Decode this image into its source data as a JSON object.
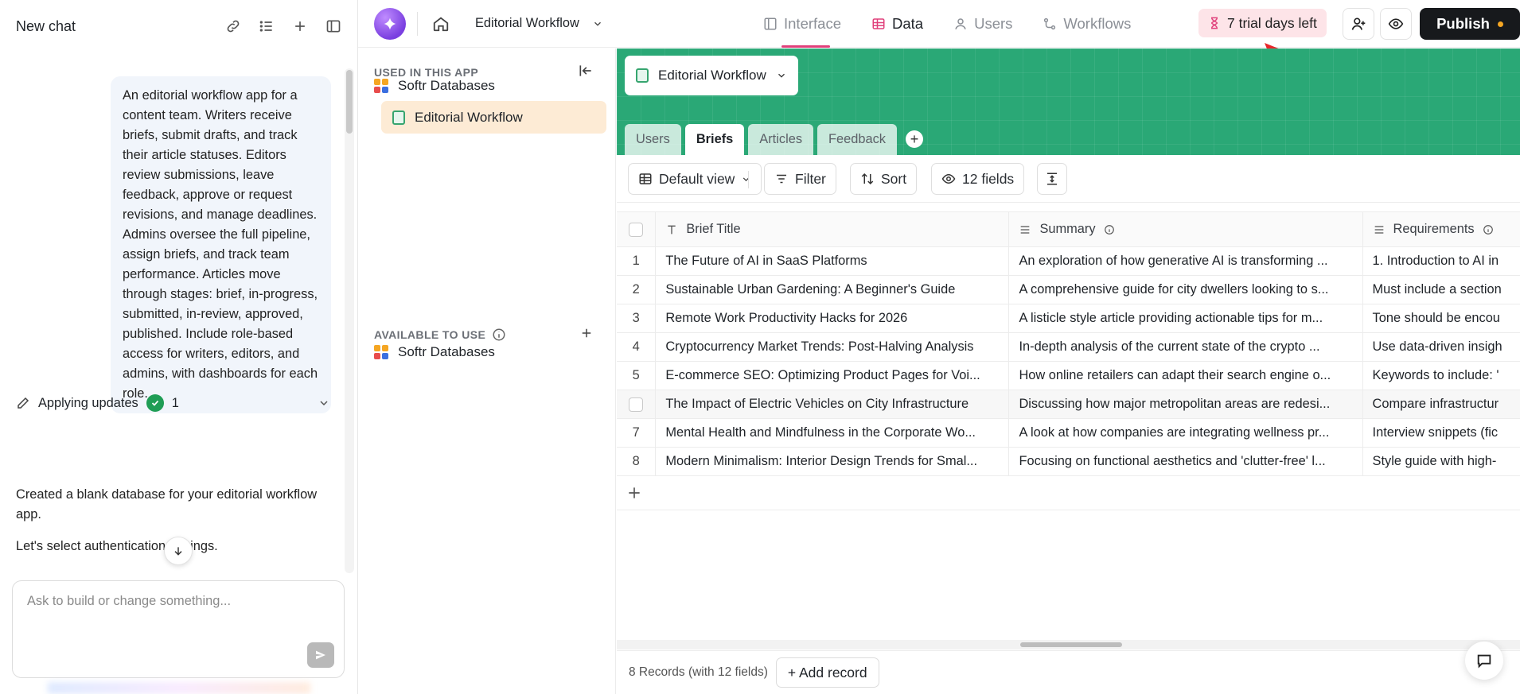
{
  "chat": {
    "title": "New chat",
    "prompt": "An editorial workflow app for a content team. Writers receive briefs, submit drafts, and track their article statuses. Editors review submissions, leave feedback, approve or request revisions, and manage deadlines. Admins oversee the full pipeline, assign briefs, and track team performance. Articles move through stages: brief, in-progress, submitted, in-review, approved, published. Include role-based access for writers, editors, and admins, with dashboards for each role.",
    "status_label": "Applying updates",
    "status_count": "1",
    "message1": "Created a blank database for your editorial workflow app.",
    "message2": "Let's select authentication settings.",
    "input_placeholder": "Ask to build or change something..."
  },
  "topbar": {
    "app_name": "Editorial Workflow",
    "nav": [
      {
        "label": "Interface"
      },
      {
        "label": "Data"
      },
      {
        "label": "Users"
      },
      {
        "label": "Workflows"
      }
    ],
    "active_nav": "Data",
    "trial_text": "7 trial days left",
    "publish_label": "Publish",
    "accent_color": "#e0407b"
  },
  "sidebar": {
    "used_label": "USED IN THIS APP",
    "used_items": [
      {
        "label": "Softr Databases"
      },
      {
        "label": "Editorial Workflow"
      }
    ],
    "available_label": "AVAILABLE TO USE",
    "available_items": [
      {
        "label": "Softr Databases"
      }
    ]
  },
  "database": {
    "name": "Editorial Workflow",
    "banner_color": "#2aa876",
    "tabs": [
      {
        "label": "Users"
      },
      {
        "label": "Briefs"
      },
      {
        "label": "Articles"
      },
      {
        "label": "Feedback"
      }
    ],
    "active_tab": "Briefs",
    "toolbar": {
      "view_label": "Default view",
      "filter_label": "Filter",
      "sort_label": "Sort",
      "fields_label": "12 fields"
    },
    "columns": [
      "Brief Title",
      "Summary",
      "Requirements"
    ],
    "rows": [
      {
        "num": "1",
        "title": "The Future of AI in SaaS Platforms",
        "summary": "An exploration of how generative AI is transforming ...",
        "req": "1. Introduction to AI in"
      },
      {
        "num": "2",
        "title": "Sustainable Urban Gardening: A Beginner's Guide",
        "summary": "A comprehensive guide for city dwellers looking to s...",
        "req": "Must include a section"
      },
      {
        "num": "3",
        "title": "Remote Work Productivity Hacks for 2026",
        "summary": "A listicle style article providing actionable tips for m...",
        "req": "Tone should be encou"
      },
      {
        "num": "4",
        "title": "Cryptocurrency Market Trends: Post-Halving Analysis",
        "summary": "In-depth analysis of the current state of the crypto ...",
        "req": "Use data-driven insigh"
      },
      {
        "num": "5",
        "title": "E-commerce SEO: Optimizing Product Pages for Voi...",
        "summary": "How online retailers can adapt their search engine o...",
        "req": "Keywords to include: '"
      },
      {
        "num": "",
        "title": "The Impact of Electric Vehicles on City Infrastructure",
        "summary": "Discussing how major metropolitan areas are redesi...",
        "req": "Compare infrastructur"
      },
      {
        "num": "7",
        "title": "Mental Health and Mindfulness in the Corporate Wo...",
        "summary": "A look at how companies are integrating wellness pr...",
        "req": "Interview snippets (fic"
      },
      {
        "num": "8",
        "title": "Modern Minimalism: Interior Design Trends for Smal...",
        "summary": "Focusing on functional aesthetics and 'clutter-free' l...",
        "req": "Style guide with high-"
      }
    ],
    "footer_count": "8 Records (with 12 fields)",
    "add_record_label": "+ Add record"
  }
}
